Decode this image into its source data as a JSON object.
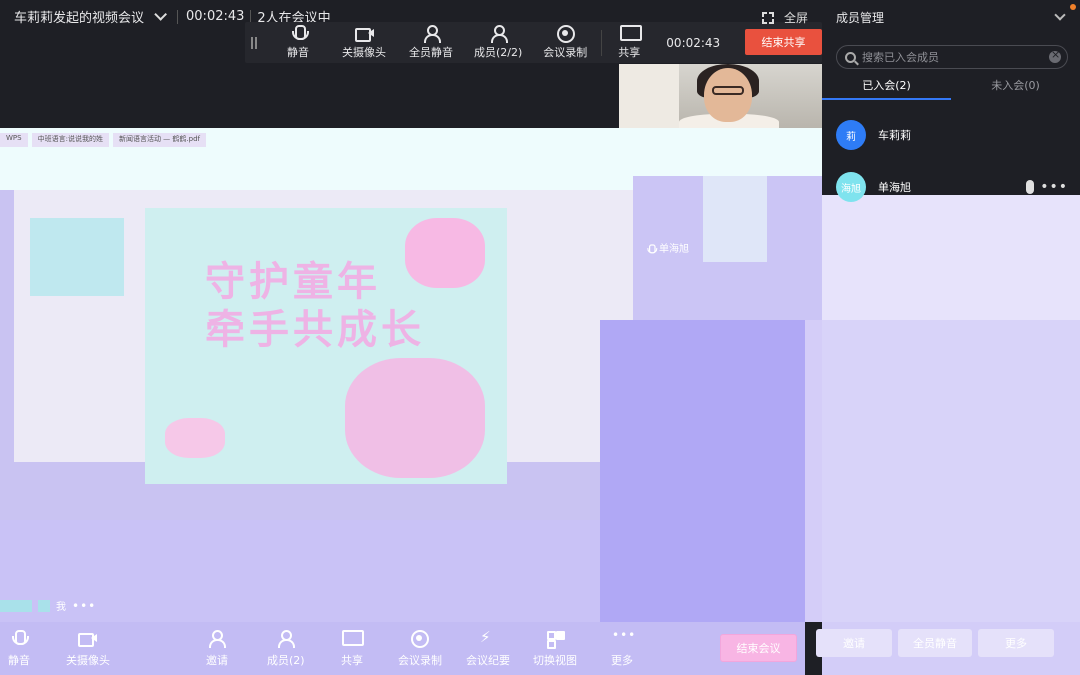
{
  "titlebar": {
    "title": "车莉莉发起的视频会议",
    "timer": "00:02:43",
    "participants": "2人在会议中",
    "fullscreen_label": "全屏"
  },
  "sharebar": {
    "mute": "静音",
    "camera_off": "关摄像头",
    "mute_all": "全员静音",
    "members": "成员(2/2)",
    "record": "会议录制",
    "share": "共享",
    "timer": "00:02:43",
    "end_share": "结束共享"
  },
  "stage": {
    "tabs": [
      "WPS",
      "中班语言:说说我的姓",
      "新闻语言活动 — 鹤鹤.pdf"
    ],
    "poster_heading_line1": "守护童年",
    "poster_heading_line2": "牵手共成长",
    "pip_member": "单海旭",
    "me_label": "我",
    "me_dots": "•••"
  },
  "bottombar": {
    "mute": "静音",
    "camera_off": "关摄像头",
    "invite": "邀请",
    "members": "成员(2)",
    "share": "共享",
    "record": "会议录制",
    "minutes": "会议纪要",
    "switch_view": "切换视图",
    "more": "更多",
    "leave": "结束会议"
  },
  "panel": {
    "title": "成员管理",
    "search_placeholder": "搜索已入会成员",
    "tab_joined": "已入会(2)",
    "tab_not_joined": "未入会(0)",
    "members": [
      {
        "avatar": "莉",
        "name": "车莉莉"
      },
      {
        "avatar": "海旭",
        "name": "单海旭"
      }
    ],
    "btn_invite": "邀请",
    "btn_mute_all": "全员静音",
    "btn_more": "更多"
  },
  "colors": {
    "end_share": "#e9513e",
    "accent_blue": "#3478f6",
    "dark_bg": "#1e1f25"
  }
}
